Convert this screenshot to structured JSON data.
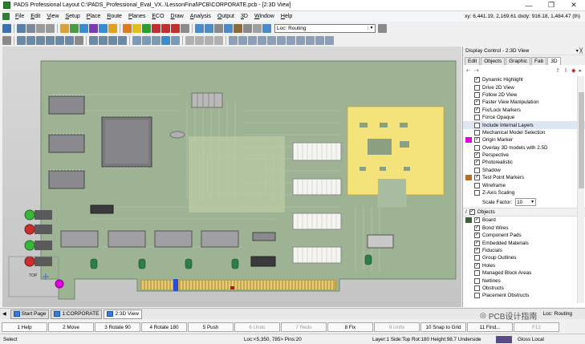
{
  "window": {
    "title": "PADS Professional Layout  C:\\PADS_Professional_Eval_VX..\\LessonFinal\\PCB\\CORPORATE.pcb - [2:3D View]",
    "min": "—",
    "max": "❐",
    "close": "✕"
  },
  "menu": [
    "File",
    "Edit",
    "View",
    "Setup",
    "Place",
    "Route",
    "Planes",
    "ECO",
    "Draw",
    "Analysis",
    "Output",
    "3D",
    "Window",
    "Help"
  ],
  "coords": "xy: 6,441.19, 2,169.61 dxdy: 916.18, 1,484.47 (th)",
  "toolbar": {
    "location": "Loc: Routing"
  },
  "panel": {
    "title": "Display Control - 2:3D View",
    "pin": "▾ ╳",
    "tabs": [
      "Edit",
      "Objects",
      "Graphic",
      "Fab",
      "3D"
    ],
    "options": [
      {
        "label": "Dynamic Highlight",
        "checked": "✓"
      },
      {
        "label": "Drive 2D View",
        "checked": ""
      },
      {
        "label": "Follow 2D View",
        "checked": ""
      },
      {
        "label": "Faster View Manipulation",
        "checked": "✓"
      },
      {
        "label": "Fix/Lock Markers",
        "checked": "✓"
      },
      {
        "label": "Force Opaque",
        "checked": ""
      },
      {
        "label": "Include Internal Layers",
        "checked": ""
      },
      {
        "label": "Mechanical Model Selection",
        "checked": ""
      },
      {
        "label": "Origin Marker",
        "checked": "✓",
        "color": "#e000e0"
      },
      {
        "label": "Overlay 3D models with 2.5D",
        "checked": ""
      },
      {
        "label": "Perspective",
        "checked": "✓"
      },
      {
        "label": "Photorealistic",
        "checked": "✓"
      },
      {
        "label": "Shadow",
        "checked": ""
      },
      {
        "label": "Test Point Markers",
        "checked": "✓",
        "color": "#b07030"
      },
      {
        "label": "Wireframe",
        "checked": ""
      },
      {
        "label": "Z-Axis Scaling",
        "checked": ""
      }
    ],
    "scale_label": "Scale Factor:",
    "scale_value": "10",
    "objects_label": "Objects",
    "objects": [
      {
        "label": "Board",
        "checked": "✓",
        "color": "#3a5f3a"
      },
      {
        "label": "Bond Wires",
        "checked": "✓"
      },
      {
        "label": "Component Pads",
        "checked": "✓"
      },
      {
        "label": "Embedded Materials",
        "checked": "✓"
      },
      {
        "label": "Fiducials",
        "checked": "✓"
      },
      {
        "label": "Group Outlines",
        "checked": ""
      },
      {
        "label": "Holes",
        "checked": "✓"
      },
      {
        "label": "Managed Block Areas",
        "checked": ""
      },
      {
        "label": "Netlines",
        "checked": ""
      },
      {
        "label": "Obstructs",
        "checked": ""
      },
      {
        "label": "Placement Obstructs",
        "checked": ""
      }
    ]
  },
  "viewtabs": [
    "Start Page",
    "1:CORPORATE",
    "2:3D View"
  ],
  "bottom_loc": "Loc: Routing",
  "watermark": "PCB设计指南",
  "fkeys": [
    {
      "label": "1 Help",
      "dis": false
    },
    {
      "label": "2 Move",
      "dis": false
    },
    {
      "label": "3 Rotate 90",
      "dis": false
    },
    {
      "label": "4 Rotate 180",
      "dis": false
    },
    {
      "label": "5 Push",
      "dis": false
    },
    {
      "label": "6 Undo",
      "dis": true
    },
    {
      "label": "7 Redo",
      "dis": true
    },
    {
      "label": "8 Fix",
      "dis": false
    },
    {
      "label": "9 Unfix",
      "dis": true
    },
    {
      "label": "10 Snap to Grid",
      "dis": false
    },
    {
      "label": "11 Find...",
      "dis": false
    },
    {
      "label": "F12",
      "dis": true
    }
  ],
  "status": {
    "left": "Select",
    "loc": "Loc:<5,350, 785> Pins:20",
    "layer": "Layer:1 Side:Top Rot:180 Height:98.7 Underside",
    "gloss": "Gloss Local"
  },
  "view": {
    "origin_label": "TOP"
  }
}
